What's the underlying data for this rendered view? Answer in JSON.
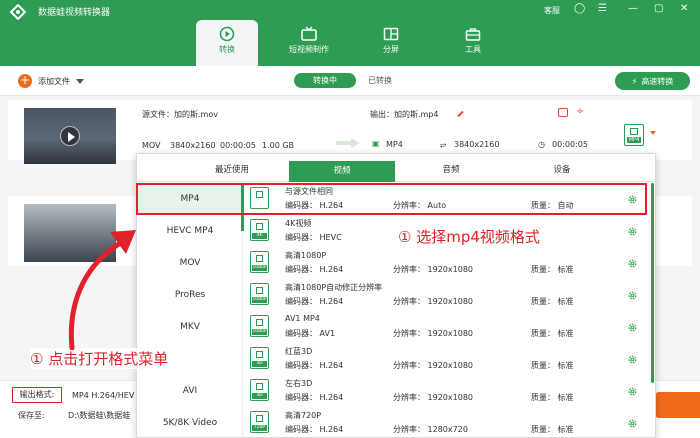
{
  "app": {
    "title": "数据蛙视频转换器",
    "support_label": "客服"
  },
  "nav": [
    {
      "label": "转换"
    },
    {
      "label": "短视频制作"
    },
    {
      "label": "分屏"
    },
    {
      "label": "工具"
    }
  ],
  "toolbar": {
    "add_file_label": "添加文件",
    "tab_converting": "转换中",
    "tab_converted": "已转换",
    "fast_convert_label": "高速转换"
  },
  "file": {
    "source_label": "源文件：加的斯.mov",
    "output_label": "输出：加的斯.mp4",
    "src_format": "MOV",
    "src_resolution": "3840x2160",
    "src_duration": "00:00:05",
    "src_size": "1.00 GB",
    "out_format": "MP4",
    "out_resolution": "3840x2160",
    "out_duration": "00:00:05"
  },
  "bottom": {
    "output_format_label": "输出格式:",
    "output_format_value": "MP4 H.264/HEV",
    "save_to_label": "保存至:",
    "save_to_value": "D:\\数据蛙\\数据蛙"
  },
  "panel": {
    "categories": [
      "最近使用",
      "视频",
      "音频",
      "设备"
    ],
    "formats": [
      "MP4",
      "HEVC MP4",
      "MOV",
      "ProRes",
      "MKV",
      "",
      "AVI",
      "5K/8K Video"
    ],
    "options": [
      {
        "name": "与源文件相同",
        "codec": "编码器：  H.264",
        "resolution": "分辨率：  Auto",
        "quality": "质量：  自动",
        "badge": ""
      },
      {
        "name": "4K视频",
        "codec": "编码器：  HEVC",
        "resolution": "",
        "quality": "",
        "badge": "4K"
      },
      {
        "name": "高清1080P",
        "codec": "编码器：  H.264",
        "resolution": "分辨率：  1920x1080",
        "quality": "质量：  标准",
        "badge": "1080P"
      },
      {
        "name": "高清1080P自动修正分辨率",
        "codec": "编码器：  H.264",
        "resolution": "分辨率：  1920x1080",
        "quality": "质量：  标准",
        "badge": "1080P"
      },
      {
        "name": "AV1 MP4",
        "codec": "编码器：  AV1",
        "resolution": "分辨率：  1920x1080",
        "quality": "质量：  标准",
        "badge": "1080P"
      },
      {
        "name": "红蓝3D",
        "codec": "编码器：  H.264",
        "resolution": "分辨率：  1920x1080",
        "quality": "质量：  标准",
        "badge": "3D"
      },
      {
        "name": "左右3D",
        "codec": "编码器：  H.264",
        "resolution": "分辨率：  1920x1080",
        "quality": "质量：  标准",
        "badge": "3D"
      },
      {
        "name": "高清720P",
        "codec": "编码器：  H.264",
        "resolution": "分辨率：  1280x720",
        "quality": "质量：  标准",
        "badge": "720P"
      }
    ]
  },
  "annotations": {
    "step_select_format": "① 选择mp4视频格式",
    "step_open_menu": "① 点击打开格式菜单"
  },
  "colors": {
    "brand_green": "#2e9c52",
    "accent_orange": "#f06a1c",
    "annotation_red": "#e0202a"
  }
}
